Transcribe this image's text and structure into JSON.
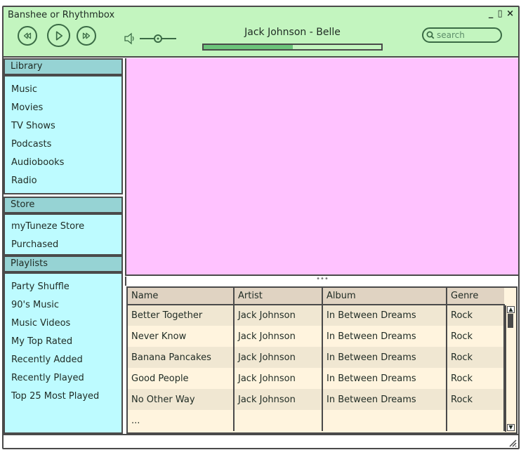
{
  "app": {
    "title": "Banshee or Rhythmbox",
    "window_controls": {
      "minimize": "_",
      "maximize": "▯",
      "close": "×"
    }
  },
  "player": {
    "prev_icon": "previous-track-icon",
    "play_icon": "play-icon",
    "next_icon": "next-track-icon",
    "volume_icon": "speaker-icon",
    "volume_level": 0.5,
    "now_playing": "Jack Johnson - Belle",
    "progress_fraction": 0.5
  },
  "search": {
    "placeholder": "search",
    "icon": "search-icon"
  },
  "sidebar": {
    "sections": [
      {
        "title": "Library",
        "items": [
          "Music",
          "Movies",
          "TV Shows",
          "Podcasts",
          "Audiobooks",
          "Radio"
        ]
      },
      {
        "title": "Store",
        "items": [
          "myTuneze Store",
          "Purchased"
        ]
      },
      {
        "title": "Playlists",
        "items": [
          "Party Shuffle",
          "90's Music",
          "Music Videos",
          "My Top Rated",
          "Recently Added",
          "Recently Played",
          "Top 25 Most Played"
        ]
      }
    ]
  },
  "tracks": {
    "columns": [
      "Name",
      "Artist",
      "Album",
      "Genre"
    ],
    "rows": [
      [
        "Better Together",
        "Jack Johnson",
        "In Between Dreams",
        "Rock"
      ],
      [
        "Never Know",
        "Jack Johnson",
        "In Between Dreams",
        "Rock"
      ],
      [
        "Banana Pancakes",
        "Jack Johnson",
        "In Between Dreams",
        "Rock"
      ],
      [
        "Good People",
        "Jack Johnson",
        "In Between Dreams",
        "Rock"
      ],
      [
        "No Other Way",
        "Jack Johnson",
        "In Between Dreams",
        "Rock"
      ],
      [
        "...",
        "",
        "",
        ""
      ]
    ]
  },
  "colors": {
    "titlebar": "#c3f5bf",
    "sidebar": "#bdfbff",
    "sidebar_header": "#96d3d4",
    "preview": "#ffc2ff",
    "table_header": "#e0d3c2",
    "table_row": "#fff4de"
  },
  "misc": {
    "splitter": "•••",
    "scroll_up": "▲",
    "scroll_down": "▼",
    "resize_grip": "resize-grip-icon"
  }
}
